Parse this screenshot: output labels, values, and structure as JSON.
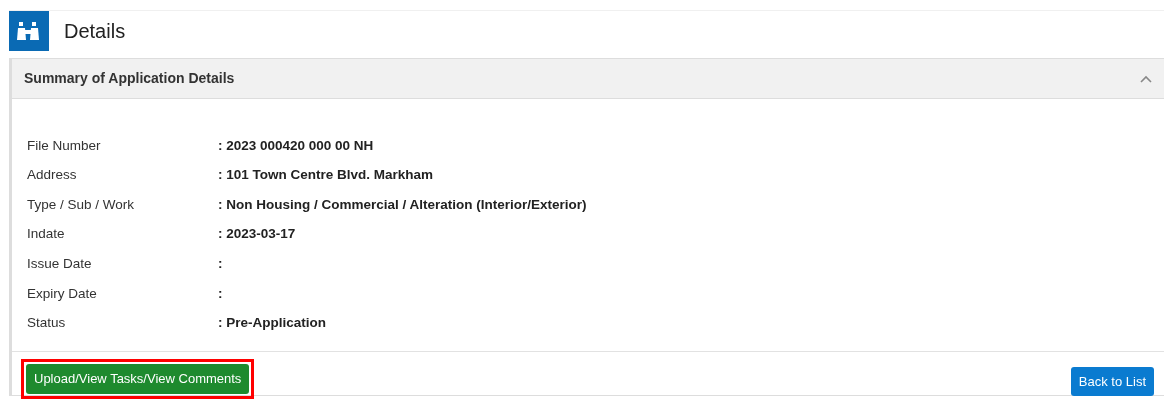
{
  "page": {
    "title": "Details"
  },
  "panel": {
    "title": "Summary of Application Details",
    "expanded": true,
    "fields": [
      {
        "label": "File Number",
        "value": ": 2023 000420 000 00 NH"
      },
      {
        "label": "Address",
        "value": ": 101 Town Centre Blvd. Markham"
      },
      {
        "label": "Type / Sub / Work",
        "value": ": Non Housing / Commercial / Alteration (Interior/Exterior)"
      },
      {
        "label": "Indate",
        "value": ": 2023-03-17"
      },
      {
        "label": "Issue Date",
        "value": ":"
      },
      {
        "label": "Expiry Date",
        "value": ":"
      },
      {
        "label": "Status",
        "value": ": Pre-Application"
      }
    ],
    "buttons": [
      {
        "label": "Upload/View Tasks/View Comments",
        "kind": "success",
        "highlighted": true
      },
      {
        "label": "Back to List",
        "kind": "primary"
      }
    ]
  }
}
